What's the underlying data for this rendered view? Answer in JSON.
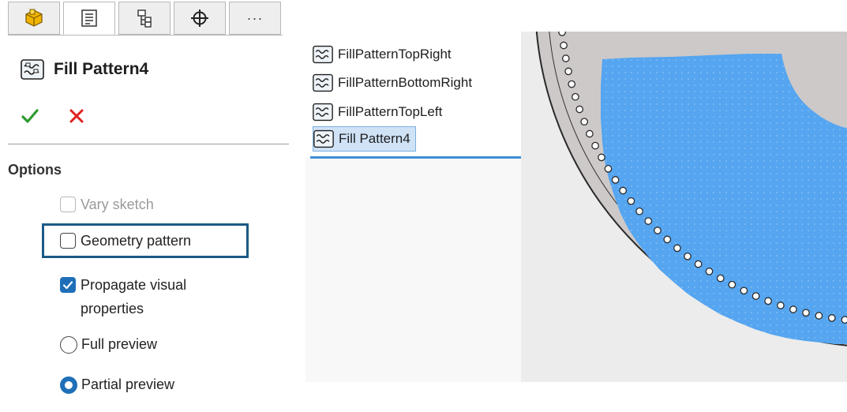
{
  "property_manager": {
    "tabs": [
      {
        "name": "feature-manager-tab",
        "icon": "part-features-icon"
      },
      {
        "name": "property-manager-tab",
        "icon": "property-list-icon",
        "active": true
      },
      {
        "name": "configuration-manager-tab",
        "icon": "configuration-icon"
      },
      {
        "name": "dimxpert-manager-tab",
        "icon": "crosshair-icon"
      },
      {
        "name": "more-tab",
        "label": "···",
        "icon": "more-icon"
      }
    ],
    "title": "Fill Pattern4",
    "ok_icon": "checkmark-icon",
    "cancel_icon": "x-icon",
    "options": {
      "heading": "Options",
      "vary_sketch": {
        "label": "Vary sketch",
        "checked": false,
        "disabled": true
      },
      "geometry_pattern": {
        "label": "Geometry pattern",
        "checked": false
      },
      "propagate_visual_properties": {
        "label_line1": "Propagate visual",
        "label_line2": "properties",
        "checked": true
      },
      "full_preview": {
        "label": "Full preview",
        "selected": false
      },
      "partial_preview": {
        "label": "Partial preview",
        "selected": true
      }
    }
  },
  "feature_tree": {
    "items": [
      {
        "label": "FillPatternTopRight",
        "icon": "fill-pattern-icon"
      },
      {
        "label": "FillPatternBottomRight",
        "icon": "fill-pattern-icon"
      },
      {
        "label": "FillPatternTopLeft",
        "icon": "fill-pattern-icon"
      },
      {
        "label": "Fill Pattern4",
        "icon": "fill-pattern-icon",
        "selected": true
      }
    ]
  },
  "colors": {
    "accent": "#1f6fb8",
    "highlight_border": "#1b5a86",
    "fill_preview": "#55a5f0",
    "ok_green": "#2e9a2e",
    "cancel_red": "#e02020"
  }
}
